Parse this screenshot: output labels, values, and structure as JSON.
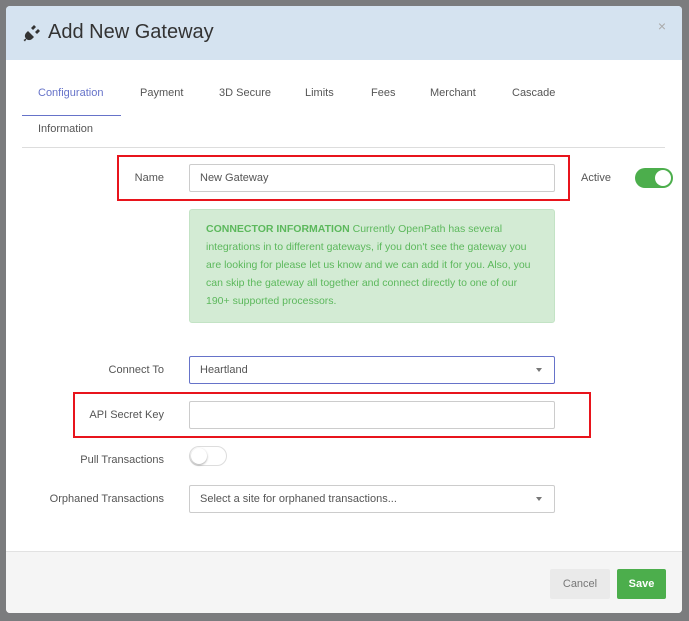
{
  "modal": {
    "title": "Add New Gateway",
    "title_icon": "plug-icon",
    "close_label": "×"
  },
  "tabs": [
    {
      "label": "Configuration",
      "active": true
    },
    {
      "label": "Payment"
    },
    {
      "label": "3D Secure"
    },
    {
      "label": "Limits"
    },
    {
      "label": "Fees"
    },
    {
      "label": "Merchant"
    },
    {
      "label": "Cascade"
    },
    {
      "label": "Information"
    }
  ],
  "form": {
    "name_label": "Name",
    "name_value": "New Gateway",
    "active_label": "Active",
    "active_on": true,
    "info_title": "CONNECTOR INFORMATION",
    "info_text": " Currently OpenPath has several integrations in to different gateways, if you don't see the gateway you are looking for please let us know and we can add it for you. Also, you can skip the gateway all together and connect directly to one of our 190+ supported processors.",
    "connect_label": "Connect To",
    "connect_value": "Heartland",
    "api_label": "API Secret Key",
    "api_value": "",
    "pull_label": "Pull Transactions",
    "pull_on": false,
    "orphaned_label": "Orphaned Transactions",
    "orphaned_placeholder": "Select a site for orphaned transactions..."
  },
  "footer": {
    "cancel_label": "Cancel",
    "save_label": "Save"
  },
  "colors": {
    "header_bg": "#d5e3f0",
    "accent": "#6673c9",
    "success": "#4cae4c",
    "highlight": "#e8141c"
  }
}
